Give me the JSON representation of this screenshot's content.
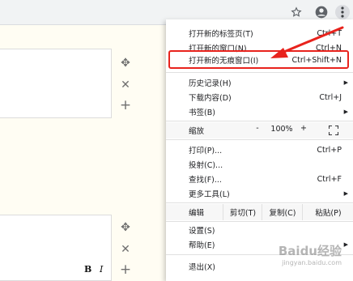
{
  "menu": {
    "new_tab": {
      "label": "打开新的标签页(T)",
      "shortcut": "Ctrl+T"
    },
    "new_window": {
      "label": "打开新的窗口(N)",
      "shortcut": "Ctrl+N"
    },
    "new_incognito": {
      "label": "打开新的无痕窗口(I)",
      "shortcut": "Ctrl+Shift+N"
    },
    "history": {
      "label": "历史记录(H)"
    },
    "downloads": {
      "label": "下载内容(D)",
      "shortcut": "Ctrl+J"
    },
    "bookmarks": {
      "label": "书签(B)"
    },
    "zoom": {
      "label": "缩放",
      "minus": "-",
      "value": "100%",
      "plus": "+"
    },
    "print": {
      "label": "打印(P)...",
      "shortcut": "Ctrl+P"
    },
    "cast": {
      "label": "投射(C)..."
    },
    "find": {
      "label": "查找(F)...",
      "shortcut": "Ctrl+F"
    },
    "more_tools": {
      "label": "更多工具(L)"
    },
    "edit": {
      "label": "编辑",
      "cut": "剪切(T)",
      "copy": "复制(C)",
      "paste": "粘贴(P)"
    },
    "settings": {
      "label": "设置(S)"
    },
    "help": {
      "label": "帮助(E)"
    },
    "exit": {
      "label": "退出(X)"
    }
  },
  "editor": {
    "bold": "B",
    "italic": "I"
  },
  "watermark": {
    "text": "Baidu经验",
    "sub": "jingyan.baidu.com"
  },
  "colors": {
    "highlight": "#e8231d",
    "arrow": "#e8231d"
  },
  "icons": [
    "star-icon",
    "account-icon",
    "more-vert-icon",
    "move-icon",
    "close-icon",
    "add-icon",
    "fullscreen-icon"
  ]
}
